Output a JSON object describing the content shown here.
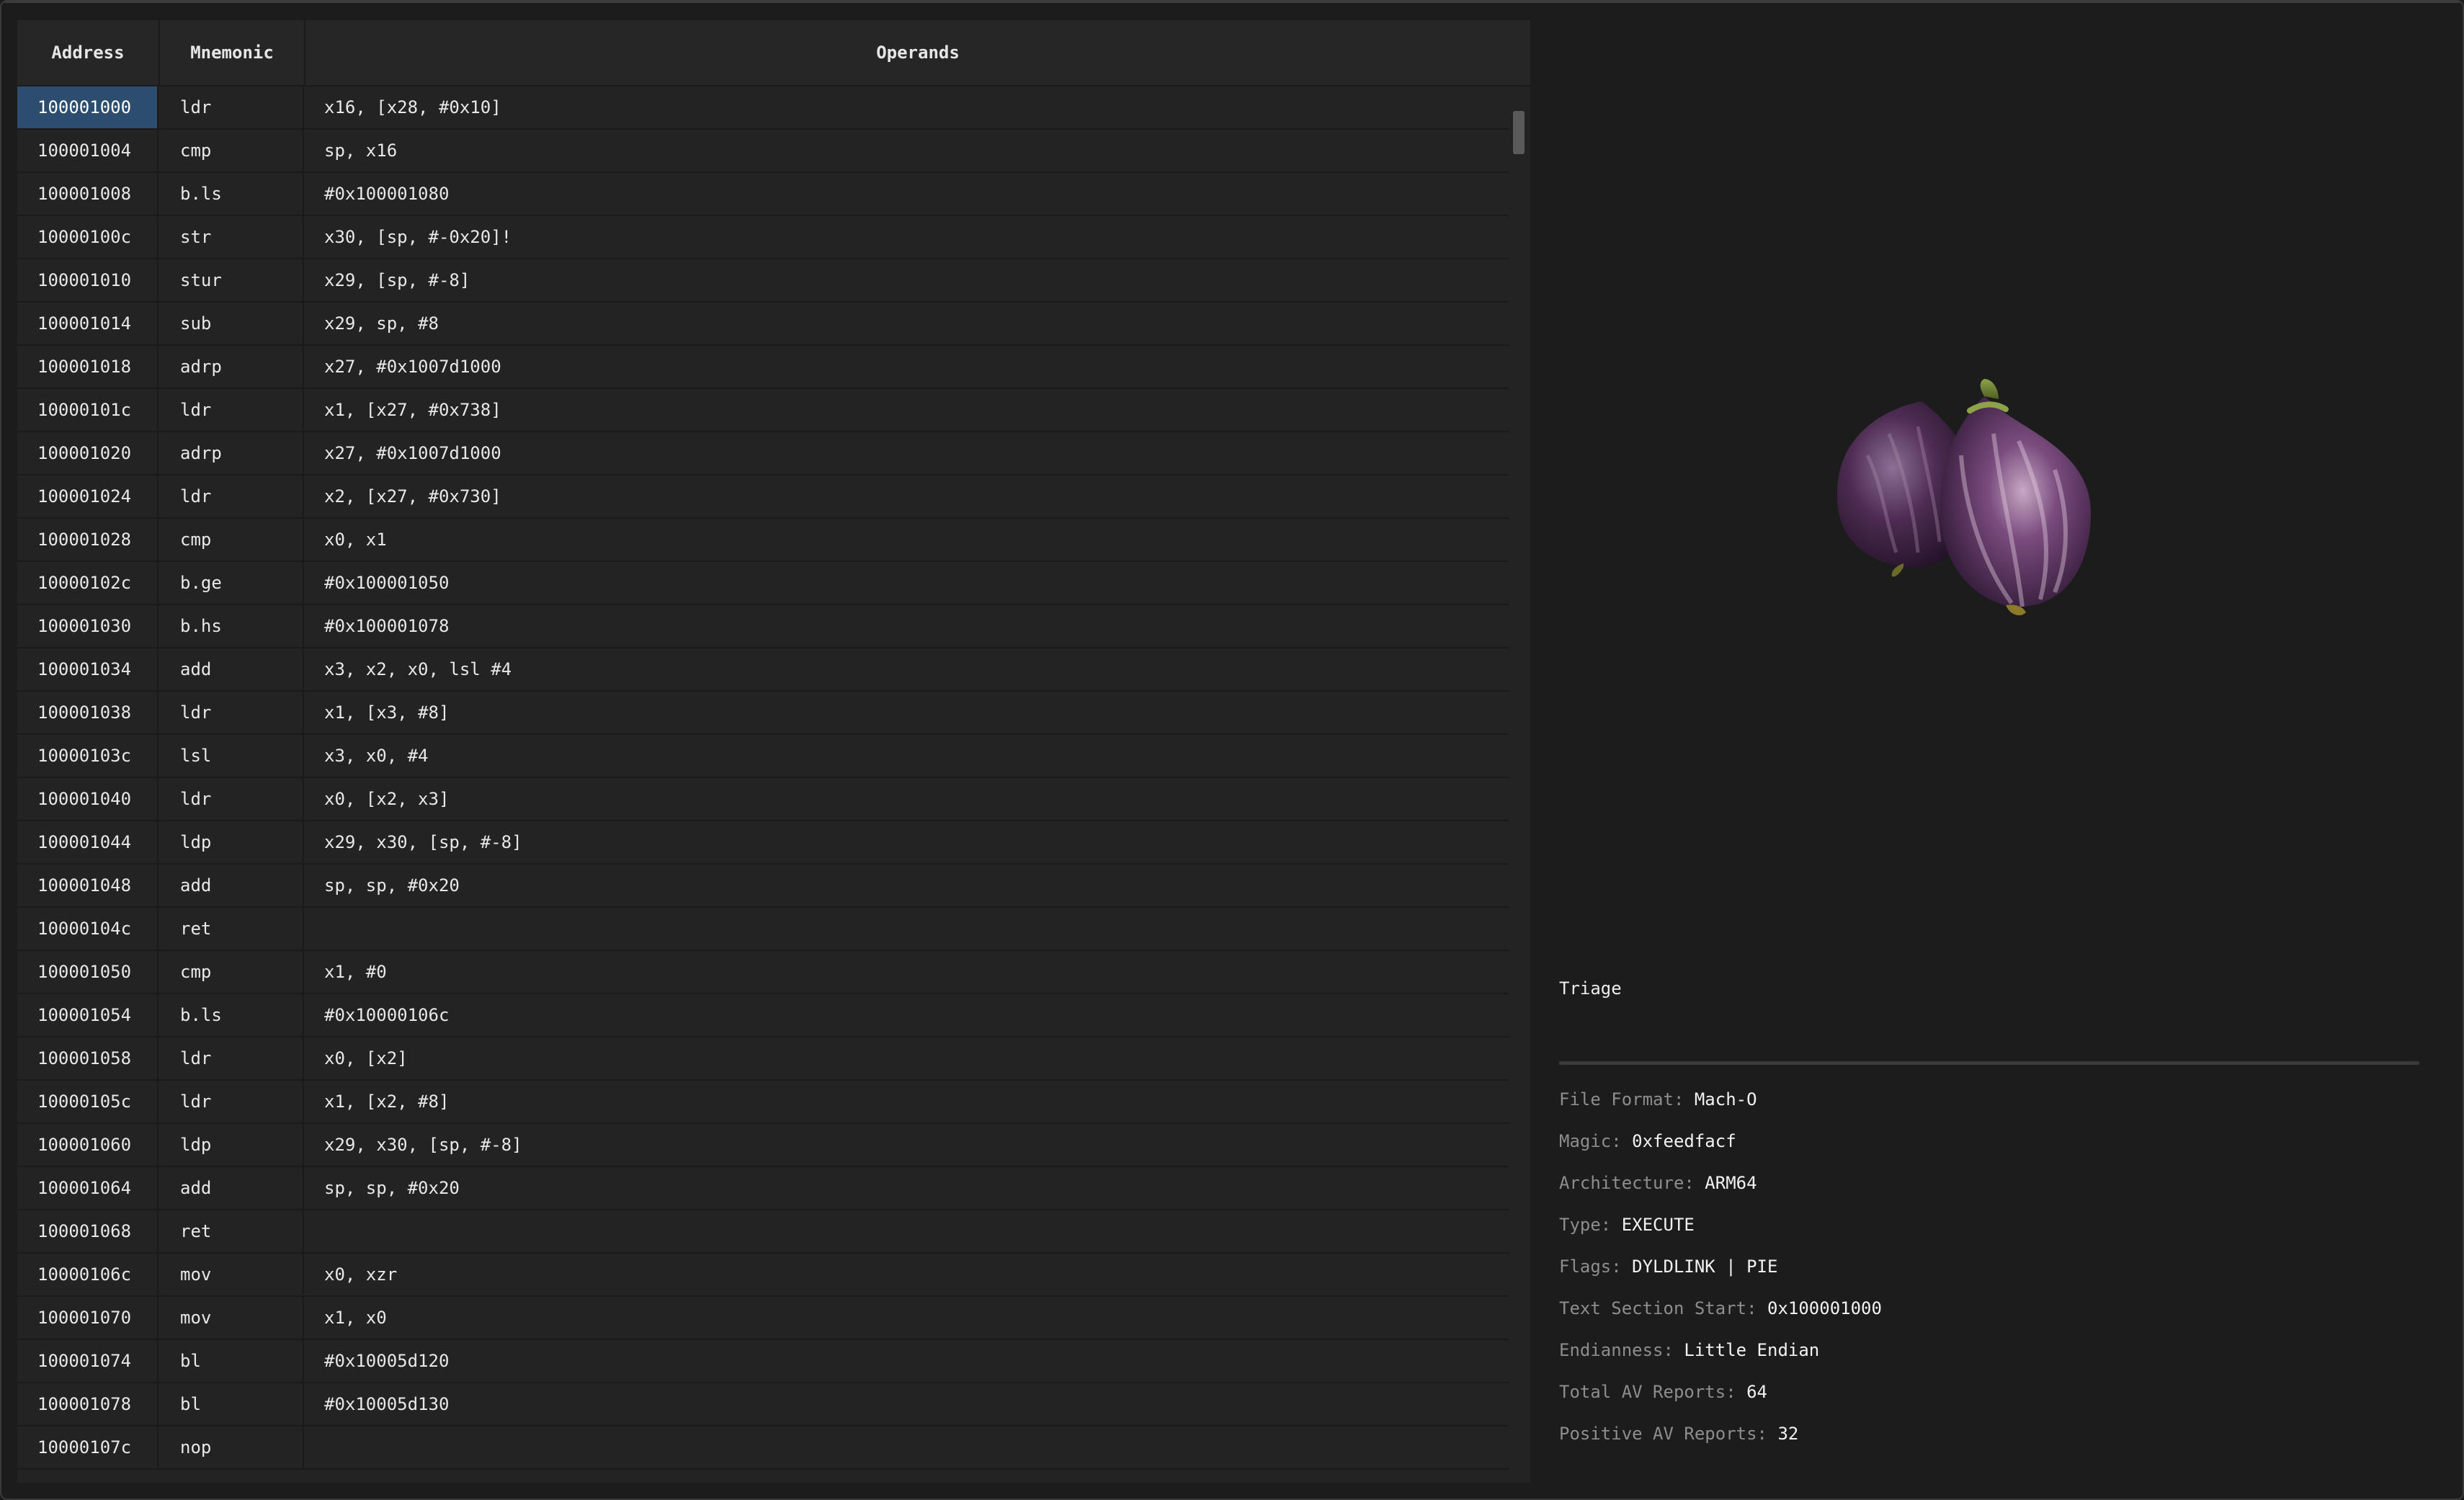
{
  "table": {
    "headers": {
      "address": "Address",
      "mnemonic": "Mnemonic",
      "operands": "Operands"
    },
    "rows": [
      {
        "address": "100001000",
        "mnemonic": "ldr",
        "operands": "x16, [x28, #0x10]"
      },
      {
        "address": "100001004",
        "mnemonic": "cmp",
        "operands": "sp, x16"
      },
      {
        "address": "100001008",
        "mnemonic": "b.ls",
        "operands": "#0x100001080"
      },
      {
        "address": "10000100c",
        "mnemonic": "str",
        "operands": "x30, [sp, #-0x20]!"
      },
      {
        "address": "100001010",
        "mnemonic": "stur",
        "operands": "x29, [sp, #-8]"
      },
      {
        "address": "100001014",
        "mnemonic": "sub",
        "operands": "x29, sp, #8"
      },
      {
        "address": "100001018",
        "mnemonic": "adrp",
        "operands": "x27, #0x1007d1000"
      },
      {
        "address": "10000101c",
        "mnemonic": "ldr",
        "operands": "x1, [x27, #0x738]"
      },
      {
        "address": "100001020",
        "mnemonic": "adrp",
        "operands": "x27, #0x1007d1000"
      },
      {
        "address": "100001024",
        "mnemonic": "ldr",
        "operands": "x2, [x27, #0x730]"
      },
      {
        "address": "100001028",
        "mnemonic": "cmp",
        "operands": "x0, x1"
      },
      {
        "address": "10000102c",
        "mnemonic": "b.ge",
        "operands": "#0x100001050"
      },
      {
        "address": "100001030",
        "mnemonic": "b.hs",
        "operands": "#0x100001078"
      },
      {
        "address": "100001034",
        "mnemonic": "add",
        "operands": "x3, x2, x0, lsl #4"
      },
      {
        "address": "100001038",
        "mnemonic": "ldr",
        "operands": "x1, [x3, #8]"
      },
      {
        "address": "10000103c",
        "mnemonic": "lsl",
        "operands": "x3, x0, #4"
      },
      {
        "address": "100001040",
        "mnemonic": "ldr",
        "operands": "x0, [x2, x3]"
      },
      {
        "address": "100001044",
        "mnemonic": "ldp",
        "operands": "x29, x30, [sp, #-8]"
      },
      {
        "address": "100001048",
        "mnemonic": "add",
        "operands": "sp, sp, #0x20"
      },
      {
        "address": "10000104c",
        "mnemonic": "ret",
        "operands": ""
      },
      {
        "address": "100001050",
        "mnemonic": "cmp",
        "operands": "x1, #0"
      },
      {
        "address": "100001054",
        "mnemonic": "b.ls",
        "operands": "#0x10000106c"
      },
      {
        "address": "100001058",
        "mnemonic": "ldr",
        "operands": "x0, [x2]"
      },
      {
        "address": "10000105c",
        "mnemonic": "ldr",
        "operands": "x1, [x2, #8]"
      },
      {
        "address": "100001060",
        "mnemonic": "ldp",
        "operands": "x29, x30, [sp, #-8]"
      },
      {
        "address": "100001064",
        "mnemonic": "add",
        "operands": "sp, sp, #0x20"
      },
      {
        "address": "100001068",
        "mnemonic": "ret",
        "operands": ""
      },
      {
        "address": "10000106c",
        "mnemonic": "mov",
        "operands": "x0, xzr"
      },
      {
        "address": "100001070",
        "mnemonic": "mov",
        "operands": "x1, x0"
      },
      {
        "address": "100001074",
        "mnemonic": "bl",
        "operands": "#0x10005d120"
      },
      {
        "address": "100001078",
        "mnemonic": "bl",
        "operands": "#0x10005d130"
      },
      {
        "address": "10000107c",
        "mnemonic": "nop",
        "operands": ""
      }
    ]
  },
  "triage": {
    "title": "Triage",
    "items": [
      {
        "label": "File Format:",
        "value": "Mach-O"
      },
      {
        "label": "Magic:",
        "value": "0xfeedfacf"
      },
      {
        "label": "Architecture:",
        "value": "ARM64"
      },
      {
        "label": "Type:",
        "value": "EXECUTE"
      },
      {
        "label": "Flags:",
        "value": "DYLDLINK | PIE"
      },
      {
        "label": "Text Section Start:",
        "value": "0x100001000"
      },
      {
        "label": "Endianness:",
        "value": "Little Endian"
      },
      {
        "label": "Total AV Reports:",
        "value": "64"
      },
      {
        "label": "Positive AV Reports:",
        "value": "32"
      }
    ]
  },
  "icons": {
    "logo": "fig-icon"
  },
  "colors": {
    "selected_row": "#2c4d6e",
    "background": "#1c1c1c",
    "panel": "#232323"
  }
}
